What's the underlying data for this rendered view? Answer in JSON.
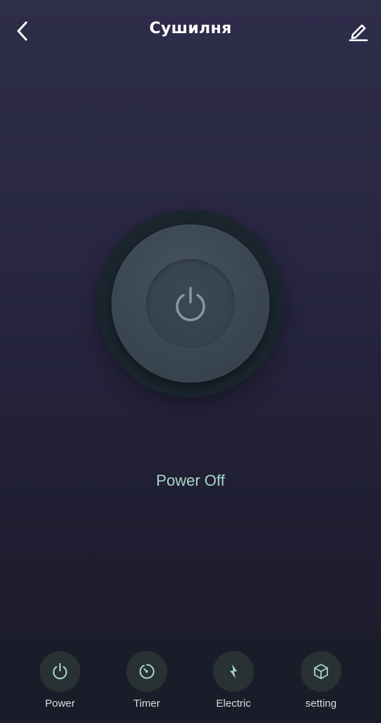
{
  "header": {
    "title": "Сушилня",
    "back_icon": "chevron-left-icon",
    "edit_icon": "pencil-icon"
  },
  "main": {
    "power_button_icon": "power-icon",
    "status_text": "Power Off"
  },
  "bottom_nav": {
    "items": [
      {
        "label": "Power",
        "icon": "power-icon"
      },
      {
        "label": "Timer",
        "icon": "timer-icon"
      },
      {
        "label": "Electric",
        "icon": "lightning-icon"
      },
      {
        "label": "setting",
        "icon": "cube-icon"
      }
    ]
  },
  "colors": {
    "accent": "#a8d6c8",
    "icon_circle": "#283133",
    "background_top": "#2e2d4a",
    "background_bottom": "#1c1c2b"
  }
}
